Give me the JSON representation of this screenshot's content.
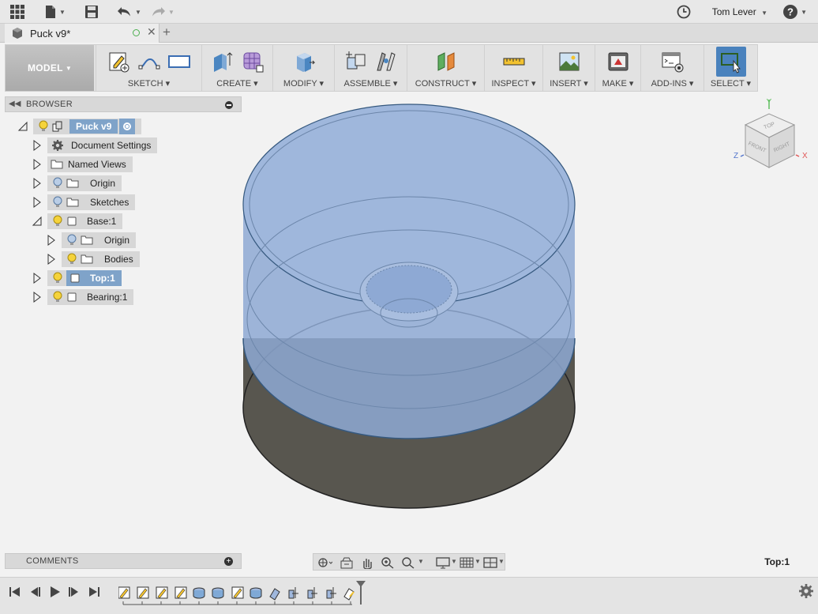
{
  "app": {
    "user_name": "Tom Lever"
  },
  "tab": {
    "title": "Puck v9*"
  },
  "ribbon": {
    "workspace": "MODEL",
    "groups": [
      "SKETCH",
      "CREATE",
      "MODIFY",
      "ASSEMBLE",
      "CONSTRUCT",
      "INSPECT",
      "INSERT",
      "MAKE",
      "ADD-INS",
      "SELECT"
    ]
  },
  "browser": {
    "title": "BROWSER",
    "root": "Puck v9",
    "items": [
      "Document Settings",
      "Named Views",
      "Origin",
      "Sketches",
      "Base:1",
      "Origin",
      "Bodies",
      "Top:1",
      "Bearing:1"
    ]
  },
  "viewcube": {
    "top": "TOP",
    "front": "FRONT",
    "right": "RIGHT",
    "axis_x": "X",
    "axis_y": "Y",
    "axis_z": "Z"
  },
  "comments": {
    "title": "COMMENTS"
  },
  "status": {
    "selection": "Top:1"
  },
  "colors": {
    "selected_highlight": "#7fa3c9",
    "body_blue": "#9fb7dc",
    "body_dark": "#5a5852",
    "accent": "#4b86c1"
  }
}
